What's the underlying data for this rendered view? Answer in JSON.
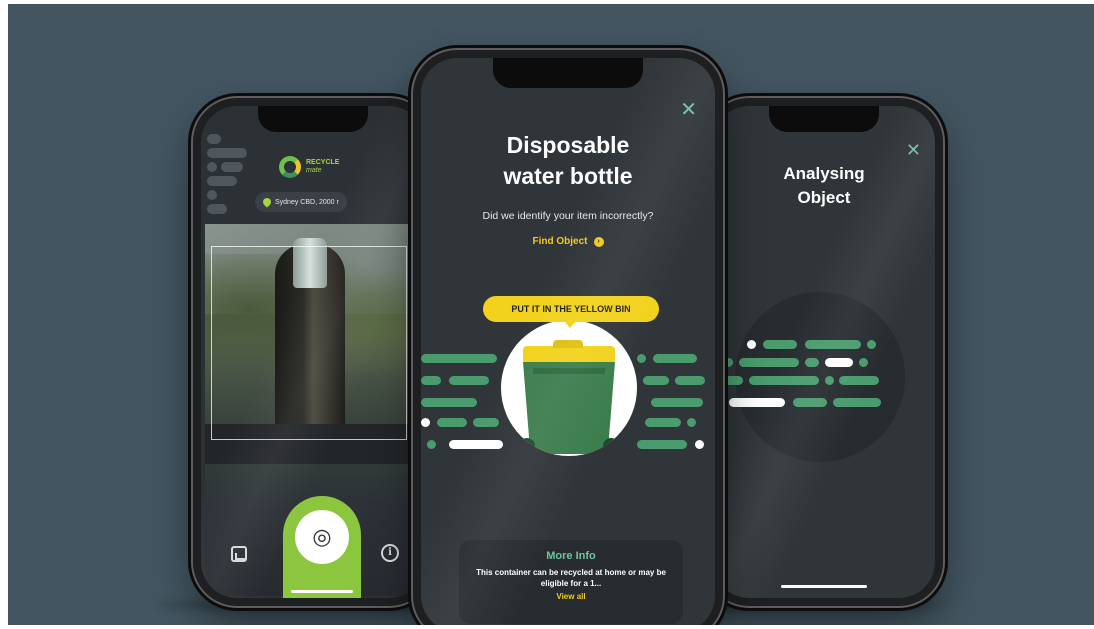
{
  "app": {
    "logo_line1": "RECYCLE",
    "logo_line2": "mate",
    "accent_green": "#8cc63f",
    "accent_yellow": "#f2d21c",
    "teal": "#6fc3a0"
  },
  "camera_screen": {
    "location": "Sydney CBD, 2000 r",
    "icons": [
      "location-pin-icon",
      "gallery-icon",
      "camera-icon",
      "info-icon"
    ]
  },
  "result_screen": {
    "title_line1": "Disposable",
    "title_line2": "water bottle",
    "question": "Did we identify your item incorrectly?",
    "find_object": "Find Object",
    "bin_instruction": "PUT IT IN THE YELLOW BIN",
    "close_icon": "✕",
    "more_info": {
      "title": "More Info",
      "body": "This container can be recycled at home or may be eligible for a 1...",
      "link": "View all"
    }
  },
  "analysing_screen": {
    "title_line1": "Analysing",
    "title_line2": "Object",
    "close_icon": "✕"
  }
}
